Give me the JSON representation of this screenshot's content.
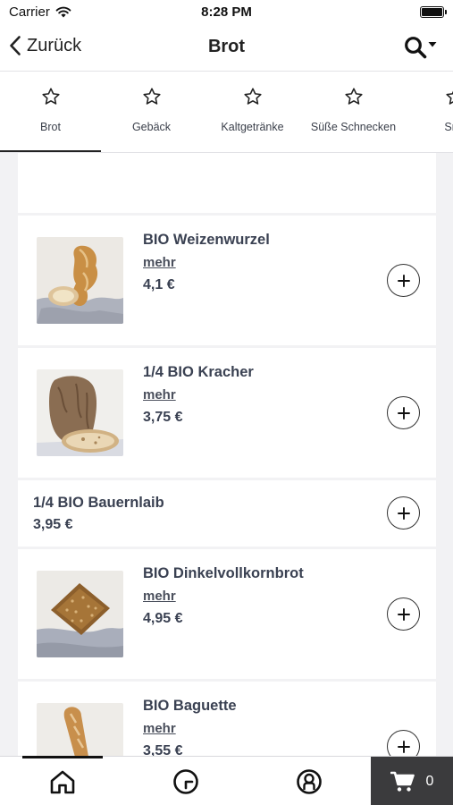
{
  "status_bar": {
    "carrier": "Carrier",
    "time": "8:28 PM"
  },
  "nav": {
    "back_label": "Zurück",
    "title": "Brot"
  },
  "tabs": [
    {
      "label": "Brot",
      "active": true
    },
    {
      "label": "Gebäck",
      "active": false
    },
    {
      "label": "Kaltgetränke",
      "active": false
    },
    {
      "label": "Süße Schnecken",
      "active": false
    },
    {
      "label": "Sna",
      "active": false
    }
  ],
  "products": [
    {
      "name": "BIO Weizenwurzel",
      "more": "mehr",
      "price": "4,1 €",
      "image": "weizenwurzel-bread"
    },
    {
      "name": "1/4 BIO Kracher",
      "more": "mehr",
      "price": "3,75 €",
      "image": "kracher-bread"
    },
    {
      "name": "1/4 BIO Bauernlaib",
      "price": "3,95 €"
    },
    {
      "name": "BIO Dinkelvollkornbrot",
      "more": "mehr",
      "price": "4,95 €",
      "image": "dinkel-bread"
    },
    {
      "name": "BIO Baguette",
      "more": "mehr",
      "price": "3,55 €",
      "image": "baguette-bread"
    }
  ],
  "bottom_bar": {
    "cart_count": "0"
  },
  "icons": {
    "back": "chevron-left-icon",
    "search": "search-dropdown-icon",
    "tab": "star-outline-icon",
    "add": "plus-circle-icon",
    "home": "home-icon",
    "clock": "clock-icon",
    "profile": "profile-icon",
    "cart": "cart-icon"
  },
  "colors": {
    "accent": "#222222",
    "cart_background": "#3b3b3d",
    "page_background": "#f2f2f4"
  }
}
